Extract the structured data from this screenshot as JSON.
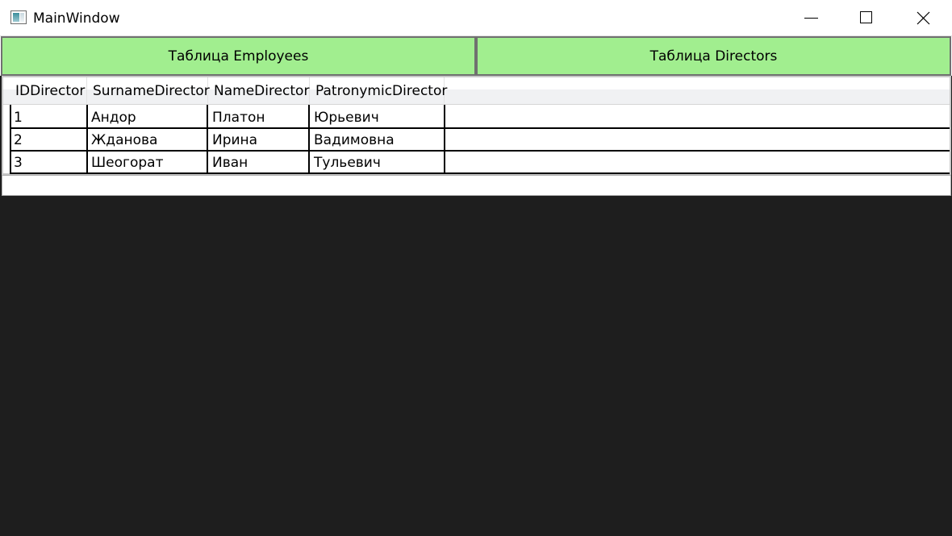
{
  "window": {
    "title": "MainWindow"
  },
  "caption_buttons": {
    "minimize": "minimize-icon",
    "maximize": "maximize-icon",
    "close": "close-icon"
  },
  "buttons": {
    "employees_label": "Таблица Employees",
    "directors_label": "Таблица Directors",
    "color": "#a1ee8f"
  },
  "grid": {
    "columns": [
      "IDDirector",
      "SurnameDirector",
      "NameDirector",
      "PatronymicDirector"
    ],
    "rows": [
      [
        "1",
        "Андор",
        "Платон",
        "Юрьевич"
      ],
      [
        "2",
        "Жданова",
        "Ирина",
        "Вадимовна"
      ],
      [
        "3",
        "Шеогорат",
        "Иван",
        "Тульевич"
      ]
    ]
  },
  "textbox": {
    "value": ""
  }
}
